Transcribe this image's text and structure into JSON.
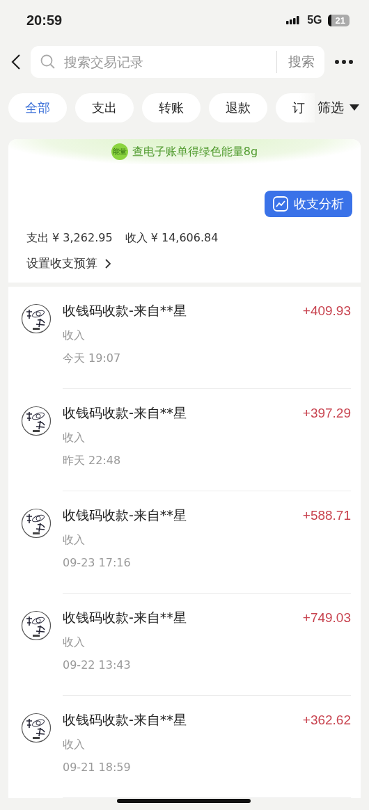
{
  "status_bar": {
    "time": "20:59",
    "network": "5G",
    "battery": "21"
  },
  "search": {
    "placeholder": "搜索交易记录",
    "button": "搜索"
  },
  "tabs": [
    {
      "label": "全部",
      "selected": true
    },
    {
      "label": "支出",
      "selected": false
    },
    {
      "label": "转账",
      "selected": false
    },
    {
      "label": "退款",
      "selected": false
    },
    {
      "label": "订",
      "selected": false
    }
  ],
  "filter": {
    "label": "筛选"
  },
  "banner": {
    "badge": "能量",
    "text": "查电子账单得绿色能量8g"
  },
  "analysis_button": "收支分析",
  "summary": {
    "expense": "支出 ¥ 3,262.95",
    "income": "收入 ¥ 14,606.84"
  },
  "budget_link": "设置收支预算",
  "transactions": [
    {
      "title": "收钱码收款-来自**星",
      "category": "收入",
      "time": "今天 19:07",
      "amount": "+409.93"
    },
    {
      "title": "收钱码收款-来自**星",
      "category": "收入",
      "time": "昨天 22:48",
      "amount": "+397.29"
    },
    {
      "title": "收钱码收款-来自**星",
      "category": "收入",
      "time": "09-23 17:16",
      "amount": "+588.71"
    },
    {
      "title": "收钱码收款-来自**星",
      "category": "收入",
      "time": "09-22 13:43",
      "amount": "+749.03"
    },
    {
      "title": "收钱码收款-来自**星",
      "category": "收入",
      "time": "09-21 18:59",
      "amount": "+362.62"
    }
  ]
}
